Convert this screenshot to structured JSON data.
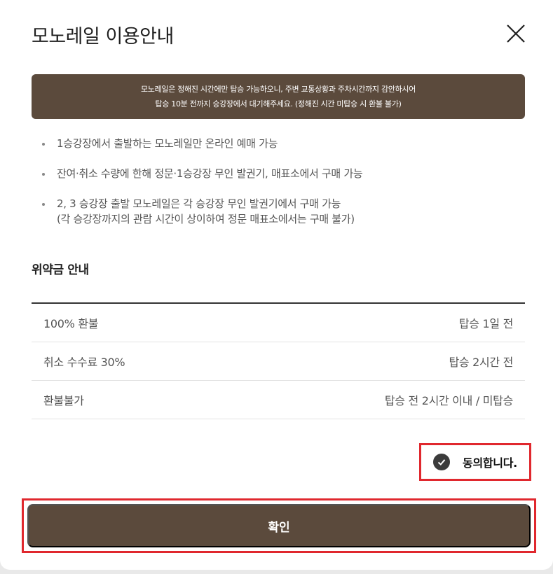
{
  "modal": {
    "title": "모노레일 이용안내",
    "close_icon": "close-icon"
  },
  "notice": {
    "line1": "모노레일은 정해진 시간에만 탑승 가능하오니, 주변 교통상황과 주차시간까지 감안하시어",
    "line2": "탑승 10분 전까지 승강장에서 대기해주세요. (정해진 시간 미탑승 시 환불 불가)",
    "background_color": "#5b4a3c"
  },
  "bullets": [
    {
      "line1": "1승강장에서 출발하는 모노레일만 온라인 예매 가능",
      "line2": ""
    },
    {
      "line1": "잔여·취소 수량에 한해 정문·1승강장 무인 발권기, 매표소에서 구매 가능",
      "line2": ""
    },
    {
      "line1": "2, 3 승강장 출발 모노레일은 각 승강장 무인 발권기에서 구매 가능",
      "line2": "(각 승강장까지의 관람 시간이 상이하여 정문 매표소에서는 구매 불가)"
    }
  ],
  "fees": {
    "title": "위약금 안내",
    "rows": [
      {
        "label": "100% 환불",
        "condition": "탑승 1일 전"
      },
      {
        "label": "취소 수수료 30%",
        "condition": "탑승 2시간 전"
      },
      {
        "label": "환불불가",
        "condition": "탑승 전 2시간 이내 / 미탑승"
      }
    ]
  },
  "agree": {
    "label": "동의합니다.",
    "checked": true,
    "icon": "check-circle-icon"
  },
  "confirm": {
    "label": "확인",
    "color": "#5b4a3c"
  },
  "highlight_color": "#e0282e"
}
